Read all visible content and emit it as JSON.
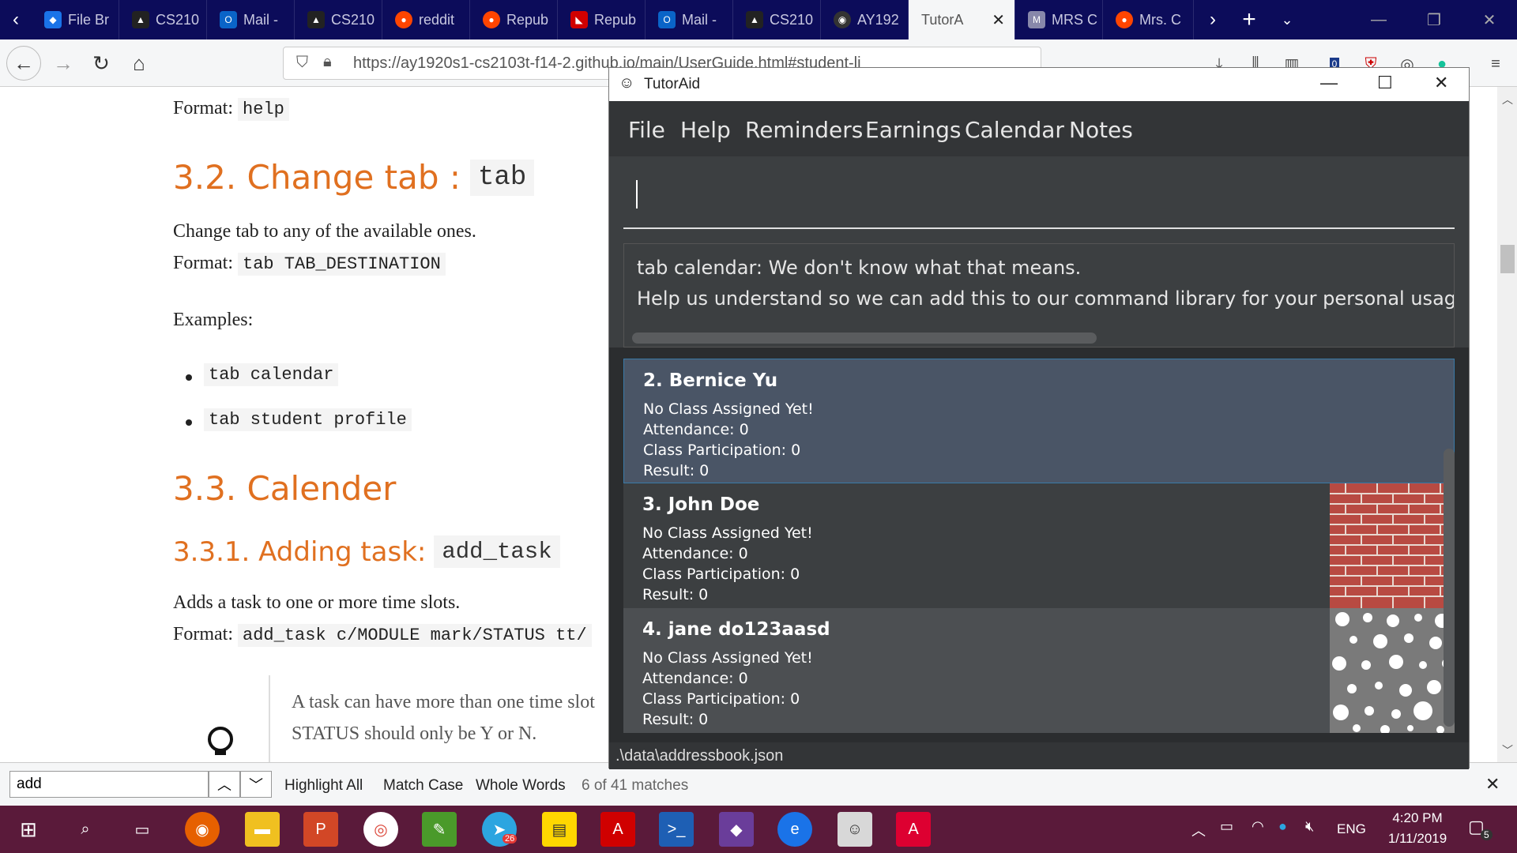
{
  "browser": {
    "tabs": [
      {
        "label": "File Br",
        "color": "#1a73e8"
      },
      {
        "label": "CS210",
        "color": "#222222"
      },
      {
        "label": "Mail -",
        "color": "#0a64c8"
      },
      {
        "label": "CS210",
        "color": "#222222"
      },
      {
        "label": "reddit",
        "color": "#ff4500"
      },
      {
        "label": "Repub",
        "color": "#ff4500"
      },
      {
        "label": "Repub",
        "color": "#d00000"
      },
      {
        "label": "Mail -",
        "color": "#0a64c8"
      },
      {
        "label": "CS210",
        "color": "#222222"
      },
      {
        "label": "AY192",
        "color": "#333333"
      },
      {
        "label": "TutorA",
        "color": "#f5f6f7"
      },
      {
        "label": "MRS C",
        "color": "#8888aa"
      },
      {
        "label": "Mrs. C",
        "color": "#ff4500"
      }
    ],
    "url": "https://ay1920s1-cs2103t-f14-2.github.io/main/UserGuide.html#student-li"
  },
  "page": {
    "format_help_label": "Format:",
    "format_help_code": "help",
    "h_change_tab": "3.2. Change tab :",
    "h_change_tab_code": "tab",
    "change_tab_desc": "Change tab to any of the available ones.",
    "format_tab_label": "Format:",
    "format_tab_code": "tab TAB_DESTINATION",
    "examples_label": "Examples:",
    "examples": [
      "tab calendar",
      "tab student profile"
    ],
    "h_calender": "3.3. Calender",
    "h_add_task": "3.3.1. Adding task:",
    "h_add_task_code": "add_task",
    "add_task_desc": "Adds a task to one or more time slots.",
    "format_add_label": "Format:",
    "format_add_code": "add_task c/MODULE mark/STATUS tt/",
    "tip_line1": "A task can have more than one time slot",
    "tip_line2": "STATUS should only be Y or N."
  },
  "findbar": {
    "query": "add",
    "highlight_all": "Highlight All",
    "match_case": "Match Case",
    "whole_words": "Whole Words",
    "matches": "6 of 41 matches"
  },
  "tutoraid": {
    "title": "TutorAid",
    "menu": [
      "File",
      "Help",
      "Reminders",
      "Earnings",
      "Calendar",
      "Notes"
    ],
    "command_value": "",
    "result_line1": "tab calendar: We don't know what that means.",
    "result_line2": "Help us understand so we can add this to our command library for your personal usage. Please",
    "students": [
      {
        "name": "2.  Bernice Yu",
        "cls": "No Class Assigned Yet!",
        "att": "Attendance: 0",
        "cp": "Class Participation: 0",
        "res": "Result: 0"
      },
      {
        "name": "3.  John Doe",
        "cls": "No Class Assigned Yet!",
        "att": "Attendance: 0",
        "cp": "Class Participation: 0",
        "res": "Result: 0"
      },
      {
        "name": "4.  jane do123aasd",
        "cls": "No Class Assigned Yet!",
        "att": "Attendance: 0",
        "cp": "Class Participation: 0",
        "res": "Result: 0"
      }
    ],
    "status_path": ".\\data\\addressbook.json"
  },
  "taskbar": {
    "time": "4:20 PM",
    "date": "1/11/2019",
    "lang": "ENG",
    "telegram_badge": "26",
    "notif_count": "5"
  }
}
